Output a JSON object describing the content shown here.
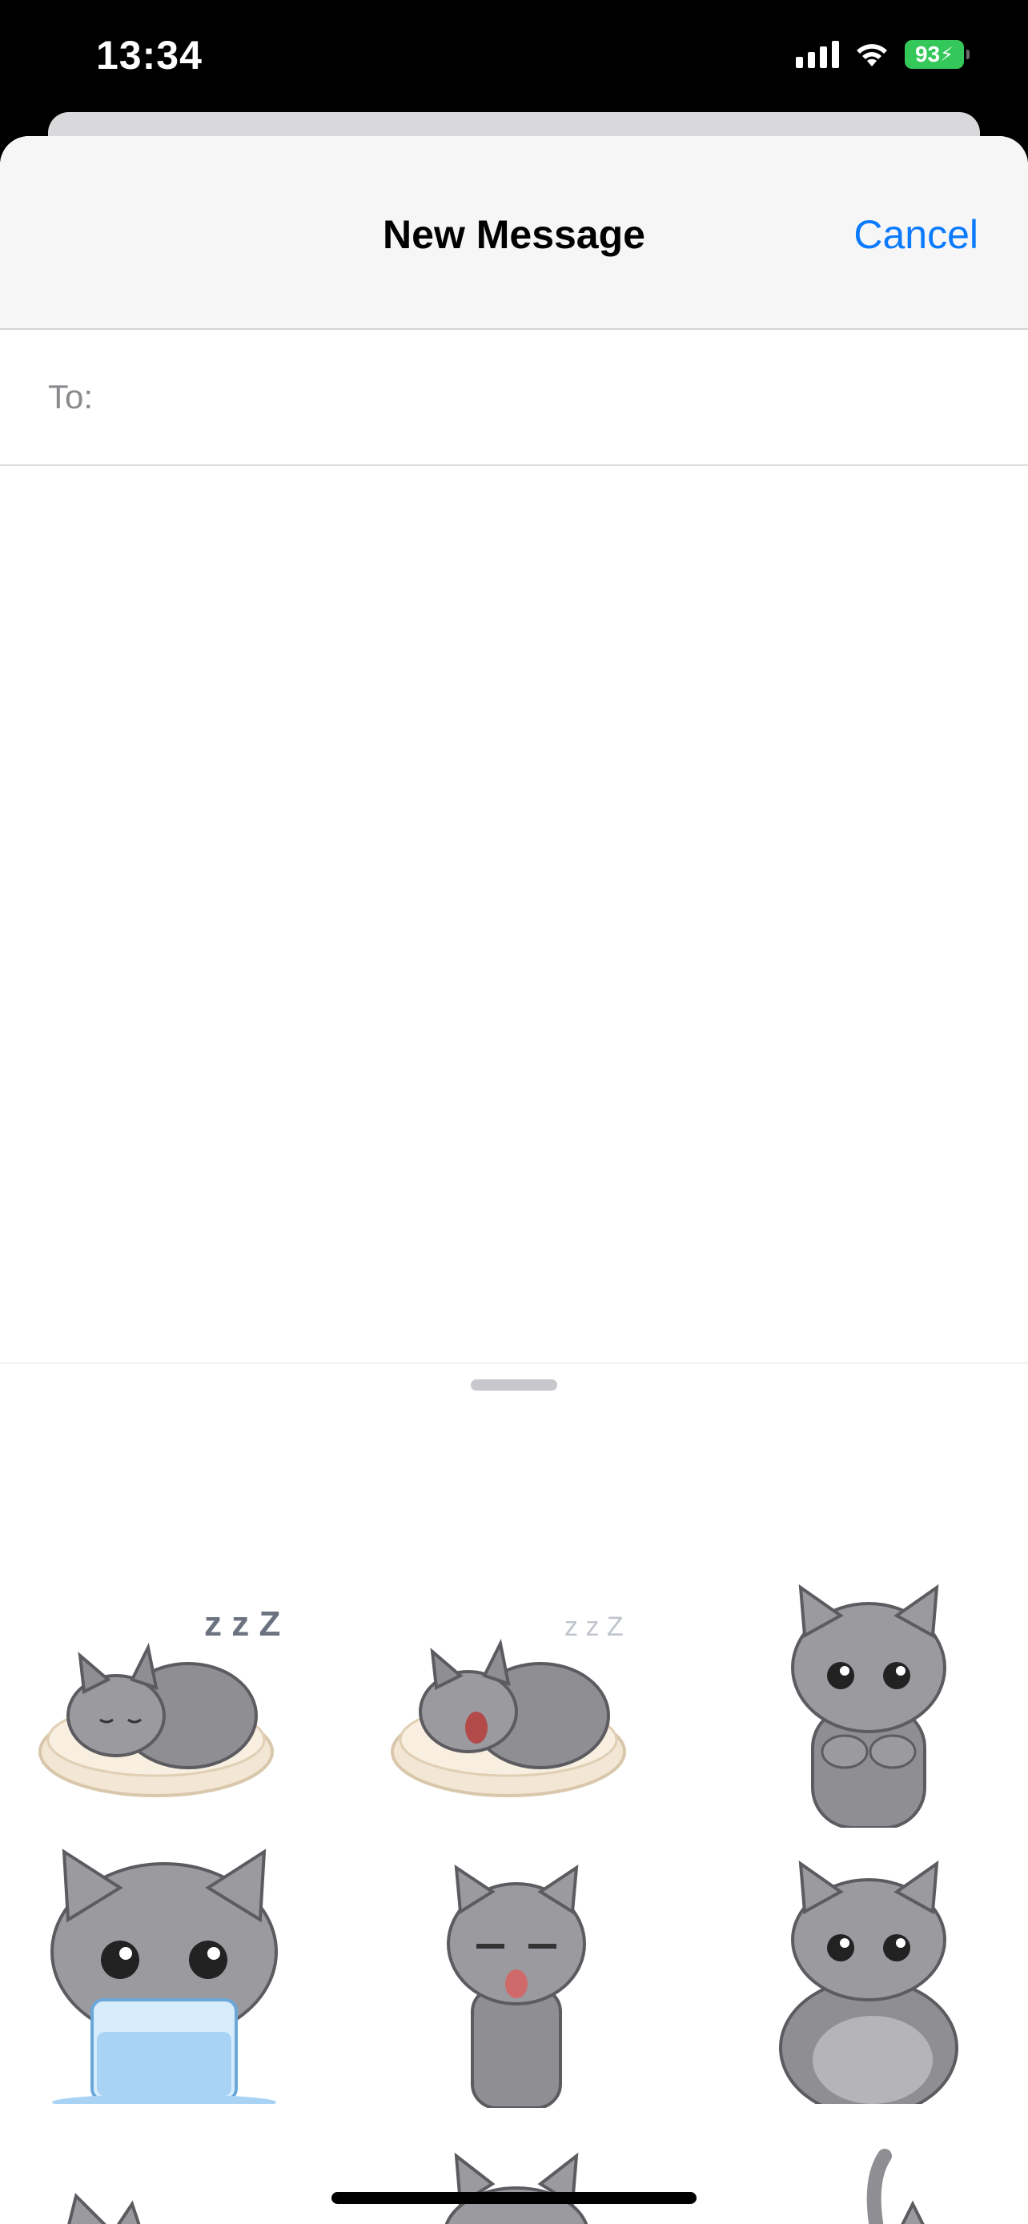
{
  "status_bar": {
    "time": "13:34",
    "battery": "93",
    "icons": [
      "cellular-signal-icon",
      "wifi-icon",
      "battery-charging-icon"
    ]
  },
  "header": {
    "title": "New Message",
    "cancel_label": "Cancel"
  },
  "recipient": {
    "label": "To:",
    "value": ""
  },
  "composer": {
    "value": "",
    "icons": [
      "plus-icon",
      "microphone-icon"
    ]
  },
  "stickers": [
    {
      "name": "sleeping-cat-sticker",
      "description": "cat sleeping on blanket"
    },
    {
      "name": "yawning-cat-sticker",
      "description": "cat yawning on blanket"
    },
    {
      "name": "standing-cat-sticker",
      "description": "cat with paws together"
    },
    {
      "name": "cat-water-glass-sticker",
      "description": "cat holding glass of water"
    },
    {
      "name": "tired-cat-sticker",
      "description": "cat with tongue out"
    },
    {
      "name": "cat-belly-sticker",
      "description": "cat holding belly"
    }
  ],
  "colors": {
    "accent": "#0a7aff",
    "battery": "#34c759",
    "header_bg": "#f6f6f6",
    "cat_fur": "#8e8e93"
  }
}
